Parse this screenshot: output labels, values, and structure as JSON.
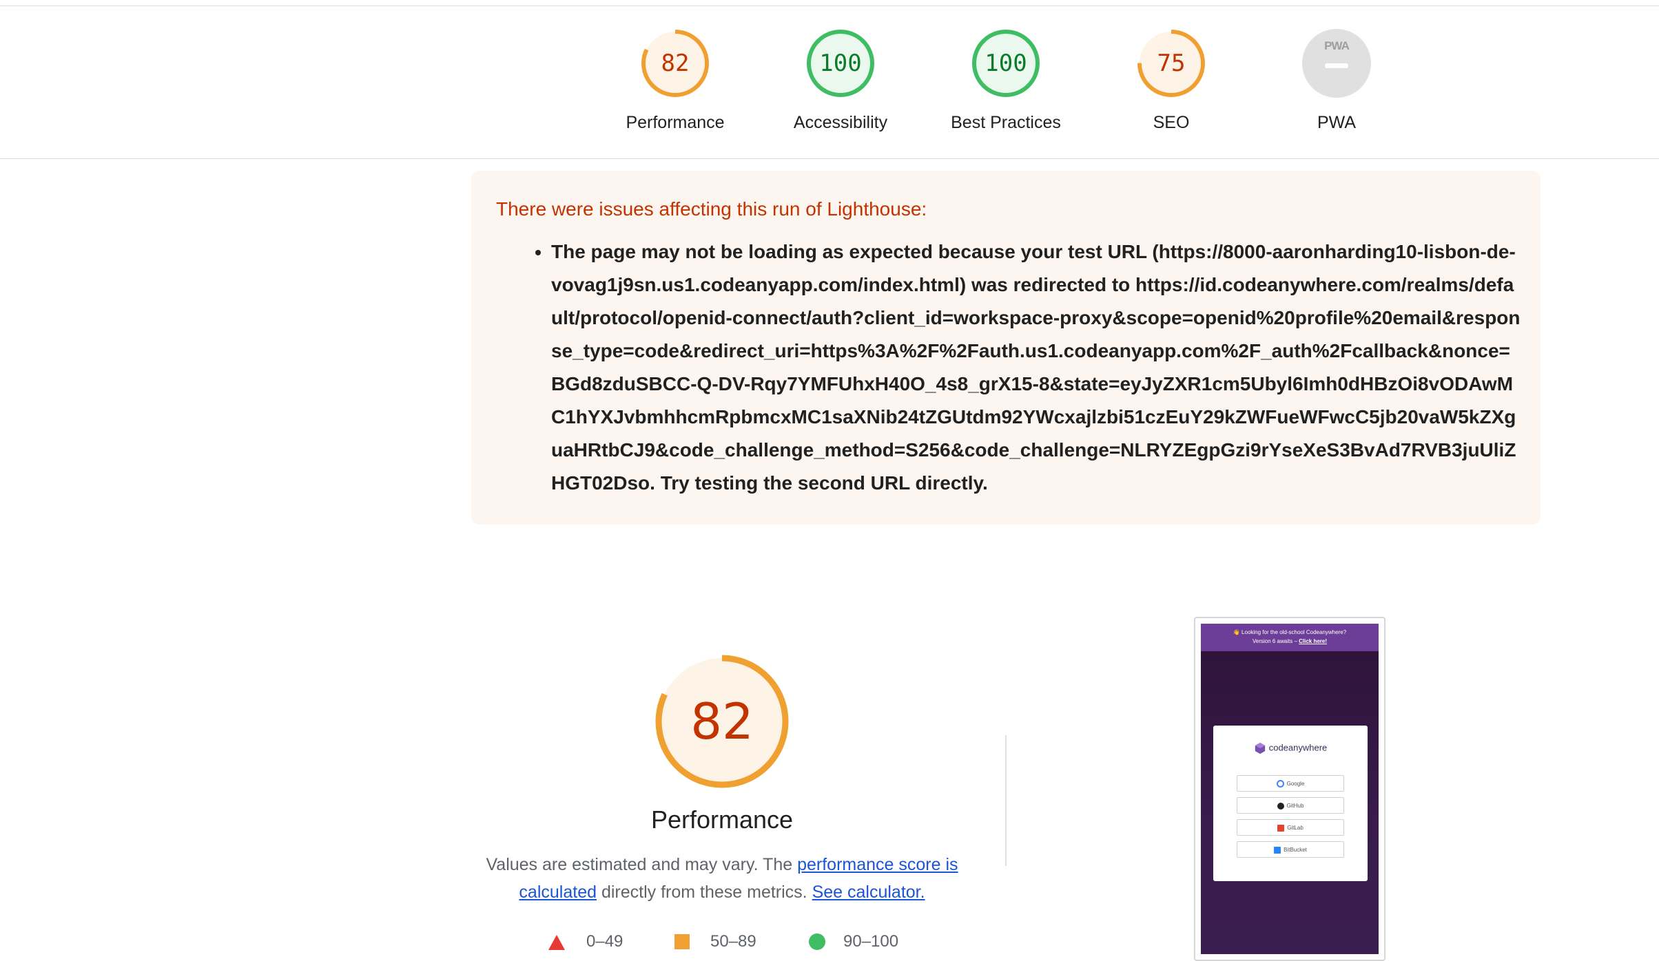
{
  "gauges": [
    {
      "score": "82",
      "label": "Performance",
      "color": "#f0a030",
      "fill": "#fdf3e6",
      "text_color": "#c33300",
      "fraction": 0.82
    },
    {
      "score": "100",
      "label": "Accessibility",
      "color": "#3ebd63",
      "fill": "#eaf8ee",
      "text_color": "#0b7a2c",
      "fraction": 1.0
    },
    {
      "score": "100",
      "label": "Best Practices",
      "color": "#3ebd63",
      "fill": "#eaf8ee",
      "text_color": "#0b7a2c",
      "fraction": 1.0
    },
    {
      "score": "75",
      "label": "SEO",
      "color": "#f0a030",
      "fill": "#fdf3e6",
      "text_color": "#c33300",
      "fraction": 0.75
    },
    {
      "score": "",
      "label": "PWA",
      "badge_text": "PWA",
      "icon": "pwa-badge-icon"
    }
  ],
  "warning": {
    "title": "There were issues affecting this run of Lighthouse:",
    "items": [
      "The page may not be loading as expected because your test URL (https://8000-aaronharding10-lisbon-de-vovag1j9sn.us1.codeanyapp.com/index.html) was redirected to https://id.codeanywhere.com/realms/default/protocol/openid-connect/auth?client_id=workspace-proxy&scope=openid%20profile%20email&response_type=code&redirect_uri=https%3A%2F%2Fauth.us1.codeanyapp.com%2F_auth%2Fcallback&nonce=BGd8zduSBCC-Q-DV-Rqy7YMFUhxH40O_4s8_grX15-8&state=eyJyZXR1cm5Ubyl6Imh0dHBzOi8vODAwMC1hYXJvbmhhcmRpbmcxMC1saXNib24tZGUtdm92YWcxajlzbi51czEuY29kZWFueWFwcC5jb20vaW5kZXguaHRtbCJ9&code_challenge_method=S256&code_challenge=NLRYZEgpGzi9rYseXeS3BvAd7RVB3juUliZHGT02Dso. Try testing the second URL directly."
    ]
  },
  "performance": {
    "score": "82",
    "fraction": 0.82,
    "title": "Performance",
    "desc_prefix": "Values are estimated and may vary. The ",
    "desc_link1": "performance score is calculated",
    "desc_middle": " directly from these metrics. ",
    "desc_link2": "See calculator.",
    "legend": [
      {
        "range": "0–49",
        "icon": "triangle-icon",
        "color": "#e53935"
      },
      {
        "range": "50–89",
        "icon": "square-icon",
        "color": "#f0a030"
      },
      {
        "range": "90–100",
        "icon": "circle-icon",
        "color": "#3ebd63"
      }
    ]
  },
  "screenshot": {
    "banner_line1": "👋 Looking for the old-school Codeanywhere?",
    "banner_line2": "Version 6 awaits – ",
    "banner_link": "Click here!",
    "brand": "codeanywhere",
    "buttons": [
      "Google",
      "GitHub",
      "GitLab",
      "BitBucket"
    ]
  }
}
